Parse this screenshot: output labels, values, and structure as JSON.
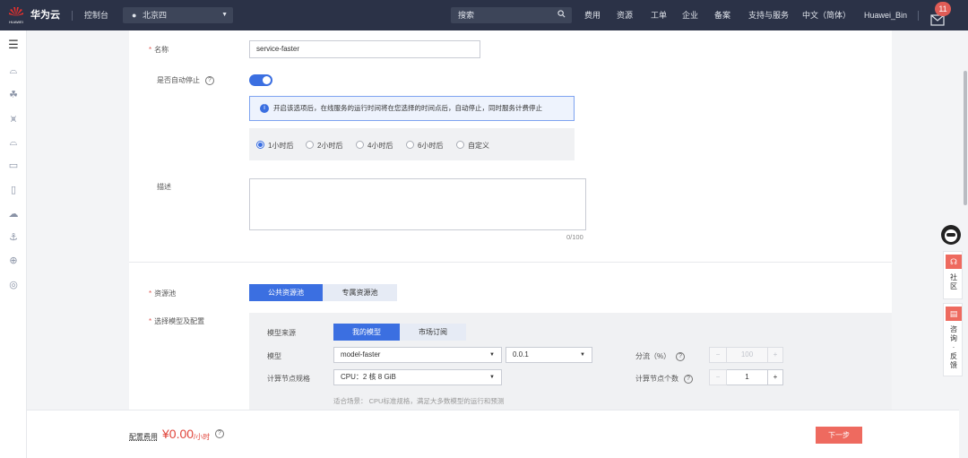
{
  "topbar": {
    "brand": "华为云",
    "console": "控制台",
    "region": "北京四",
    "search_placeholder": "搜索",
    "nav": [
      "费用",
      "资源",
      "工单",
      "企业",
      "备案",
      "支持与服务",
      "中文（简体）",
      "Huawei_Bin"
    ],
    "message_count": "11"
  },
  "form": {
    "name_label": "名称",
    "name_value": "service-faster",
    "auto_stop_label": "是否自动停止",
    "auto_stop_enabled": true,
    "info_text": "开启该选项后，在线服务的运行时间将在您选择的时间点后，自动停止，同时服务计费停止",
    "stop_options": [
      "1小时后",
      "2小时后",
      "4小时后",
      "6小时后",
      "自定义"
    ],
    "stop_selected": "1小时后",
    "desc_label": "描述",
    "desc_value": "",
    "desc_counter": "0/100",
    "pool_label": "资源池",
    "pool_options": [
      "公共资源池",
      "专属资源池"
    ],
    "pool_selected": "公共资源池",
    "model_label": "选择模型及配置",
    "model_source_label": "模型来源",
    "model_source_options": [
      "我的模型",
      "市场订阅"
    ],
    "model_source_selected": "我的模型",
    "model_field_label": "模型",
    "model_value": "model-faster",
    "version_value": "0.0.1",
    "split_label": "分流（%）",
    "split_value": "100",
    "spec_label": "计算节点规格",
    "spec_value": "CPU：2 核 8 GiB",
    "spec_hint": "适合场景： CPU标准规格，满足大多数模型的运行和预测",
    "node_count_label": "计算节点个数",
    "node_count_value": "1",
    "minus": "−",
    "plus": "+"
  },
  "footer": {
    "cost_label": "配置费用",
    "price": "¥0.00",
    "unit": "/小时",
    "next_label": "下一步"
  },
  "floatbar": {
    "community": "社区",
    "feedback": "咨询·反馈"
  },
  "colors": {
    "topbar": "#2b3247",
    "primary": "#3b6fe1",
    "accent": "#ee6a5f",
    "price": "#e0443a"
  }
}
